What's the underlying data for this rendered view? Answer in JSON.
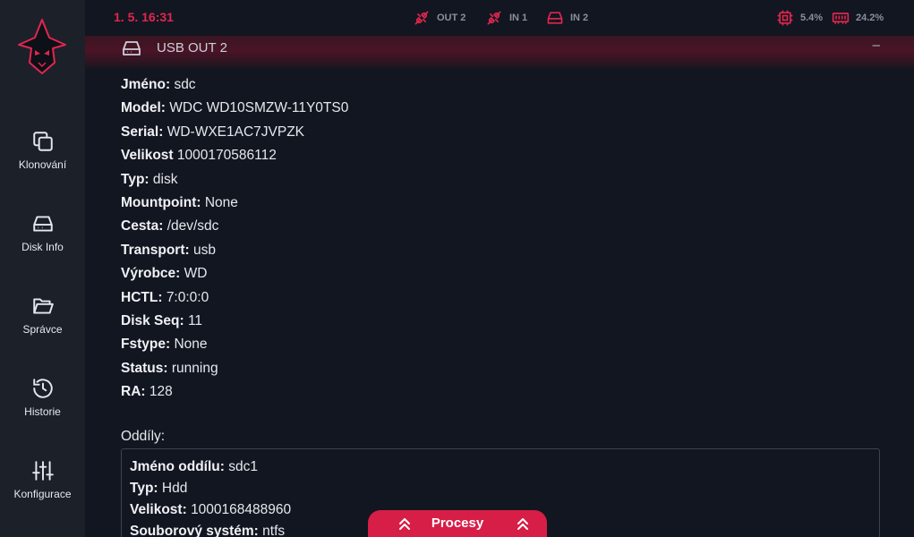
{
  "colors": {
    "accent": "#e0264f",
    "bg": "#121620",
    "sidebar_bg": "#1c2029",
    "muted": "#8a8f99"
  },
  "topbar": {
    "clock": "1. 5. 16:31",
    "indicators": [
      {
        "icon": "usb-unplugged-icon",
        "label": "OUT 2"
      },
      {
        "icon": "usb-unplugged-icon",
        "label": "IN 1"
      },
      {
        "icon": "hard-drive-icon",
        "label": "IN 2"
      }
    ],
    "cpu": {
      "icon": "cpu-icon",
      "value": "5.4%"
    },
    "ram": {
      "icon": "memory-icon",
      "value": "24.2%"
    }
  },
  "sidebar": {
    "items": [
      {
        "icon": "copy-icon",
        "label": "Klonování"
      },
      {
        "icon": "hard-drive-icon",
        "label": "Disk Info"
      },
      {
        "icon": "folder-open-icon",
        "label": "Správce"
      },
      {
        "icon": "history-icon",
        "label": "Historie"
      },
      {
        "icon": "sliders-icon",
        "label": "Konfigurace"
      }
    ]
  },
  "panel": {
    "title": "USB OUT 2",
    "collapse": "–",
    "fields": [
      {
        "key": "Jméno:",
        "value": "sdc"
      },
      {
        "key": "Model:",
        "value": "WDC WD10SMZW-11Y0TS0"
      },
      {
        "key": "Serial:",
        "value": "WD-WXE1AC7JVPZK"
      },
      {
        "key": "Velikost",
        "value": "1000170586112"
      },
      {
        "key": "Typ:",
        "value": "disk"
      },
      {
        "key": "Mountpoint:",
        "value": "None"
      },
      {
        "key": "Cesta:",
        "value": "/dev/sdc"
      },
      {
        "key": "Transport:",
        "value": "usb"
      },
      {
        "key": "Výrobce:",
        "value": "WD"
      },
      {
        "key": "HCTL:",
        "value": "7:0:0:0"
      },
      {
        "key": "Disk Seq:",
        "value": "11"
      },
      {
        "key": "Fstype:",
        "value": "None"
      },
      {
        "key": "Status:",
        "value": "running"
      },
      {
        "key": "RA:",
        "value": "128"
      }
    ],
    "partitions_label": "Oddíly:",
    "partitions": [
      {
        "key": "Jméno oddílu:",
        "value": "sdc1"
      },
      {
        "key": "Typ:",
        "value": "Hdd"
      },
      {
        "key": "Velikost:",
        "value": "1000168488960"
      },
      {
        "key": "Souborový systém:",
        "value": "ntfs"
      }
    ]
  },
  "processes": {
    "label": "Procesy"
  }
}
